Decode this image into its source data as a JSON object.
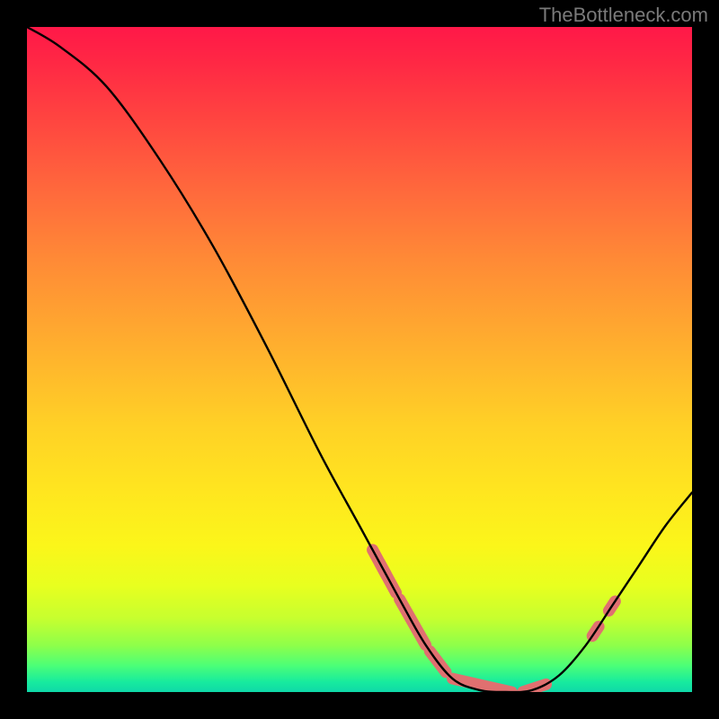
{
  "watermark": "TheBottleneck.com",
  "chart_data": {
    "type": "line",
    "title": "",
    "xlabel": "",
    "ylabel": "",
    "xlim": [
      0,
      100
    ],
    "ylim": [
      0,
      100
    ],
    "curve": [
      {
        "x": 0,
        "y": 100
      },
      {
        "x": 5,
        "y": 97
      },
      {
        "x": 12,
        "y": 91
      },
      {
        "x": 20,
        "y": 80
      },
      {
        "x": 28,
        "y": 67
      },
      {
        "x": 36,
        "y": 52
      },
      {
        "x": 44,
        "y": 36
      },
      {
        "x": 50,
        "y": 25
      },
      {
        "x": 56,
        "y": 14
      },
      {
        "x": 60,
        "y": 7
      },
      {
        "x": 64,
        "y": 2
      },
      {
        "x": 68,
        "y": 0.3
      },
      {
        "x": 72,
        "y": 0.0
      },
      {
        "x": 76,
        "y": 0.3
      },
      {
        "x": 80,
        "y": 2.5
      },
      {
        "x": 84,
        "y": 7
      },
      {
        "x": 88,
        "y": 13
      },
      {
        "x": 92,
        "y": 19
      },
      {
        "x": 96,
        "y": 25
      },
      {
        "x": 100,
        "y": 30
      }
    ],
    "marker_bands": [
      {
        "x_start": 52,
        "x_end": 54,
        "y_approx": 20
      },
      {
        "x_start": 53,
        "x_end": 55.5,
        "y_approx": 17
      },
      {
        "x_start": 56,
        "x_end": 60,
        "y_approx": 10
      },
      {
        "x_start": 60.5,
        "x_end": 63,
        "y_approx": 5
      },
      {
        "x_start": 64,
        "x_end": 73,
        "y_approx": 0.3
      },
      {
        "x_start": 74.5,
        "x_end": 78,
        "y_approx": 0.6
      },
      {
        "x_start": 85,
        "x_end": 86,
        "y_approx": 9
      },
      {
        "x_start": 87.5,
        "x_end": 88.5,
        "y_approx": 12.5
      }
    ],
    "marker_color": "#e07070",
    "curve_color": "#000000",
    "curve_width": 2.4
  }
}
